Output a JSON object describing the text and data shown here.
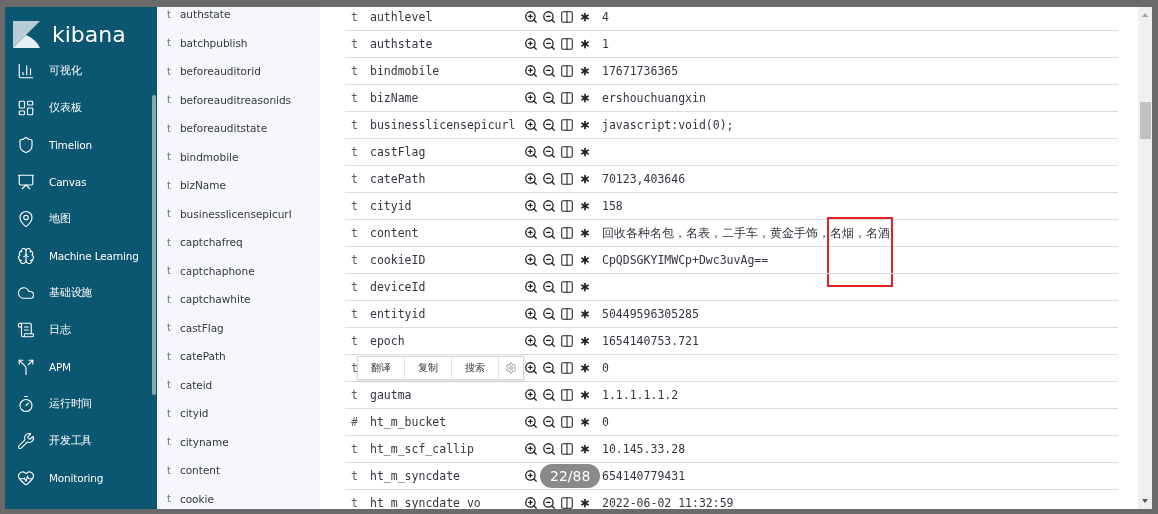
{
  "nav": {
    "logo": "kibana",
    "items": [
      {
        "label": "可视化"
      },
      {
        "label": "仪表板"
      },
      {
        "label": "Timelion"
      },
      {
        "label": "Canvas"
      },
      {
        "label": "地图"
      },
      {
        "label": "Machine Learning"
      },
      {
        "label": "基础设施"
      },
      {
        "label": "日志"
      },
      {
        "label": "APM"
      },
      {
        "label": "运行时间"
      },
      {
        "label": "开发工具"
      },
      {
        "label": "Monitoring"
      }
    ]
  },
  "field_list": [
    {
      "type": "t",
      "name": "authstate"
    },
    {
      "type": "t",
      "name": "batchpublish"
    },
    {
      "type": "t",
      "name": "beforeauditorid"
    },
    {
      "type": "t",
      "name": "beforeauditreasonids"
    },
    {
      "type": "t",
      "name": "beforeauditstate"
    },
    {
      "type": "t",
      "name": "bindmobile"
    },
    {
      "type": "t",
      "name": "bizName"
    },
    {
      "type": "t",
      "name": "businesslicensepicurl"
    },
    {
      "type": "t",
      "name": "captchafreq"
    },
    {
      "type": "t",
      "name": "captchaphone"
    },
    {
      "type": "t",
      "name": "captchawhite"
    },
    {
      "type": "t",
      "name": "castFlag"
    },
    {
      "type": "t",
      "name": "catePath"
    },
    {
      "type": "t",
      "name": "cateid"
    },
    {
      "type": "t",
      "name": "cityid"
    },
    {
      "type": "t",
      "name": "cityname"
    },
    {
      "type": "t",
      "name": "content"
    },
    {
      "type": "t",
      "name": "cookie"
    }
  ],
  "document_rows": [
    {
      "type": "t",
      "name": "authlevel",
      "value": "4"
    },
    {
      "type": "t",
      "name": "authstate",
      "value": "1"
    },
    {
      "type": "t",
      "name": "bindmobile",
      "value": "17671736365"
    },
    {
      "type": "t",
      "name": "bizName",
      "value": "ershouchuangxin"
    },
    {
      "type": "t",
      "name": "businesslicensepicurl",
      "value": "javascript:void(0);"
    },
    {
      "type": "t",
      "name": "castFlag"
    },
    {
      "type": "t",
      "name": "catePath",
      "value": "70123,403646"
    },
    {
      "type": "t",
      "name": "cityid",
      "value": "158"
    },
    {
      "type": "t",
      "name": "content",
      "value": "回收各种名包，名表，二手车，黄金手饰，名烟，名酒",
      "highlighted": true
    },
    {
      "type": "t",
      "name": "cookieID",
      "value": "CpQDSGKYIMWCp+Dwc3uvAg=="
    },
    {
      "type": "t",
      "name": "deviceId"
    },
    {
      "type": "t",
      "name": "entityid",
      "value": "50449596305285"
    },
    {
      "type": "t",
      "name": "epoch",
      "value": "1654140753.721"
    },
    {
      "type": "t",
      "value": "0",
      "popup": {
        "items": [
          "翻译",
          "复制",
          "搜索"
        ]
      }
    },
    {
      "type": "t",
      "name": "gautma",
      "value": "1.1.1.1.1.2"
    },
    {
      "type": "#",
      "name": "ht_m_bucket",
      "value": "0"
    },
    {
      "type": "t",
      "name": "ht_m_scf_callip",
      "value": "10.145.33.28"
    },
    {
      "type": "t",
      "name": "ht_m_syncdate",
      "value": "654140779431",
      "counter_badge": "22/88"
    },
    {
      "type": "t",
      "name": "ht_m_syncdate_vo",
      "value": "2022-06-02 11:32:59"
    }
  ]
}
